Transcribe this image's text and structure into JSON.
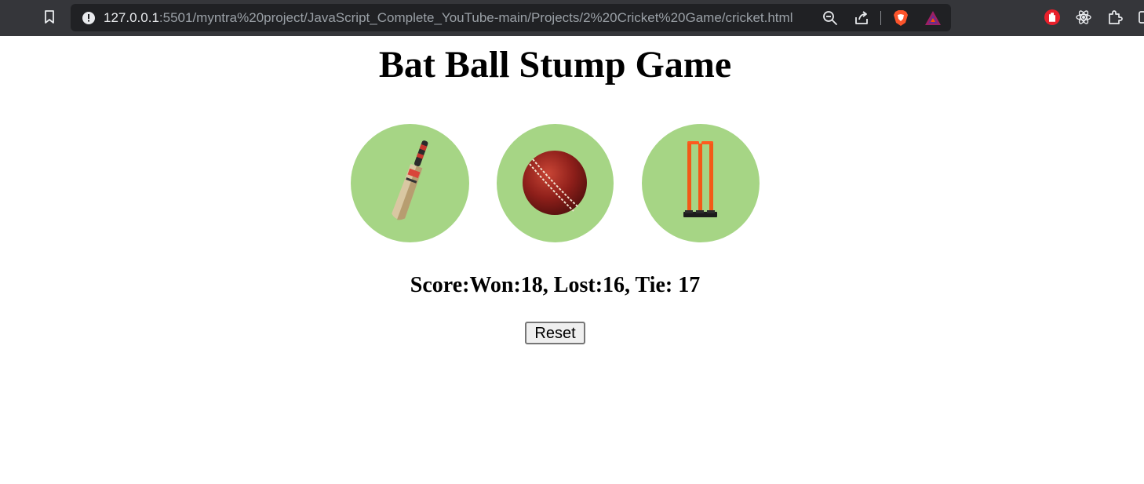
{
  "browser": {
    "url_host": "127.0.0.1",
    "url_rest": ":5501/myntra%20project/JavaScript_Complete_YouTube-main/Projects/2%20Cricket%20Game/cricket.html",
    "icons": [
      "bookmark-icon",
      "site-info-icon",
      "zoom-out-icon",
      "share-icon",
      "brave-shields-icon",
      "brave-rewards-icon",
      "adblock-extension-icon",
      "react-devtools-icon",
      "extensions-icon"
    ]
  },
  "page": {
    "title": "Bat Ball Stump Game",
    "choices": [
      {
        "name": "Bat",
        "icon": "cricket-bat-icon"
      },
      {
        "name": "Ball",
        "icon": "cricket-ball-icon"
      },
      {
        "name": "Stump",
        "icon": "cricket-stumps-icon"
      }
    ],
    "score_text": "Score:Won:18, Lost:16, Tie: 17",
    "reset_label": "Reset"
  },
  "colors": {
    "choice_circle": "#a6d585",
    "chrome_bar": "#35363a",
    "omnibox": "#202124"
  }
}
